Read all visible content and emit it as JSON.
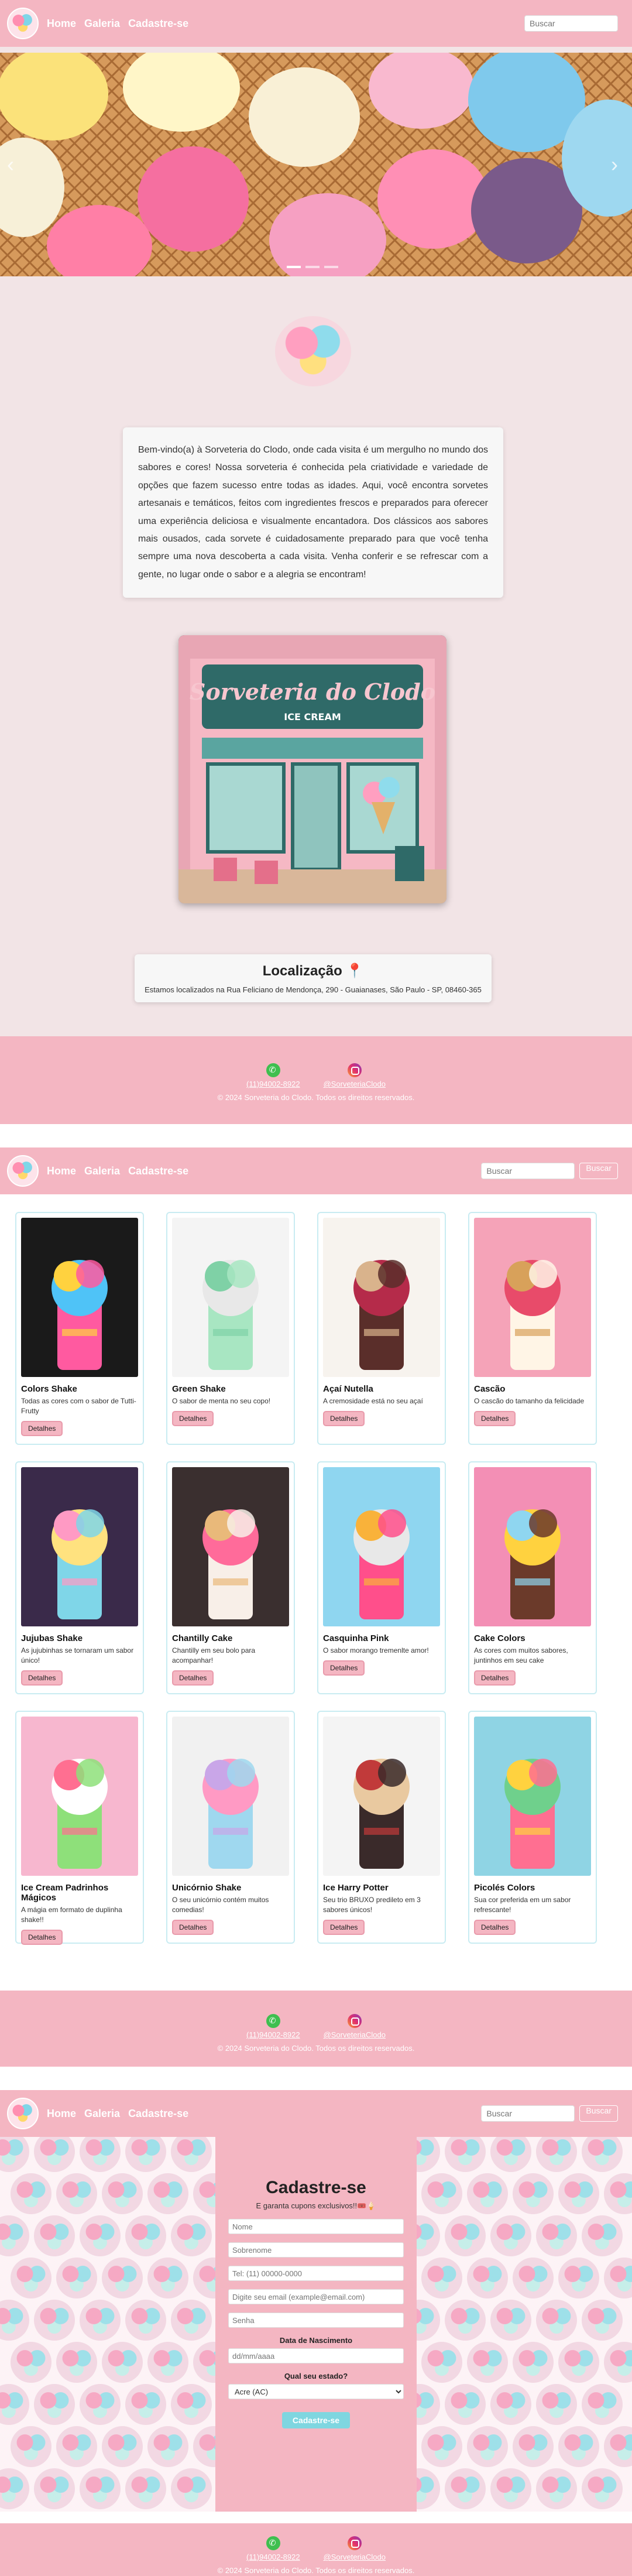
{
  "nav": {
    "links": [
      "Home",
      "Galeria",
      "Cadastre-se"
    ],
    "search_placeholder": "Buscar",
    "search_button": "Buscar"
  },
  "home": {
    "welcome_text": "Bem-vindo(a) à Sorveteria do Clodo, onde cada visita é um mergulho no mundo dos sabores e cores! Nossa sorveteria é conhecida pela criatividade e variedade de opções que fazem sucesso entre todas as idades. Aqui, você encontra sorvetes artesanais e temáticos, feitos com ingredientes frescos e preparados para oferecer uma experiência deliciosa e visualmente encantadora. Dos clássicos aos sabores mais ousados, cada sorvete é cuidadosamente preparado para que você tenha sempre uma nova descoberta a cada visita. Venha conferir e se refrescar com a gente, no lugar onde o sabor e a alegria se encontram!",
    "storefront_sign": "Sorveteria do Clodo",
    "storefront_sub": "ICE CREAM",
    "location_title": "Localização 📍",
    "location_text": "Estamos localizados na Rua Feliciano de Mendonça, 290 - Guaianases, São Paulo - SP, 08460-365"
  },
  "footer": {
    "phone": "(11)94002-8922",
    "instagram": "@SorveteriaClodo",
    "copyright": "© 2024 Sorveteria do Clodo. Todos os direitos reservados."
  },
  "gallery": {
    "button_label": "Detalhes",
    "items": [
      {
        "title": "Colors Shake",
        "desc": "Todas as cores com o sabor de Tutti-Frutty",
        "colors": [
          "#1a1a1a",
          "#ff5aa0",
          "#ffd23f",
          "#4fc3f7"
        ]
      },
      {
        "title": "Green Shake",
        "desc": "O sabor de menta no seu copo!",
        "colors": [
          "#f4f4f4",
          "#a8e6c2",
          "#7fd1a6",
          "#e8e8e8"
        ]
      },
      {
        "title": "Açaí Nutella",
        "desc": "A cremosidade está no seu açaí",
        "colors": [
          "#f7f3ee",
          "#5a2e2a",
          "#d9b38c",
          "#b52b4a"
        ]
      },
      {
        "title": "Cascão",
        "desc": "O cascão do tamanho da felicidade",
        "colors": [
          "#f5a3b8",
          "#fff5e6",
          "#d8a15a",
          "#e84b6a"
        ]
      },
      {
        "title": "Jujubas Shake",
        "desc": "As jujubinhas se tornaram um sabor único!",
        "colors": [
          "#3a2a4a",
          "#7fd6e8",
          "#ff9ac4",
          "#ffe27f"
        ]
      },
      {
        "title": "Chantilly Cake",
        "desc": "Chantilly em seu bolo para acompanhar!",
        "colors": [
          "#3a2f2f",
          "#f8efe8",
          "#e9b97a",
          "#ff6b9a"
        ]
      },
      {
        "title": "Casquinha Pink",
        "desc": "O sabor morango tremenlte amor!",
        "colors": [
          "#8fd6f0",
          "#ff4f8b",
          "#f9b23a",
          "#e8e8e8"
        ]
      },
      {
        "title": "Cake Colors",
        "desc": "As cores com muitos sabores, juntinhos em seu cake",
        "colors": [
          "#f38fb5",
          "#6b3a2a",
          "#8fd6f0",
          "#ffd23f"
        ]
      },
      {
        "title": "Ice Cream Padrinhos Mágicos",
        "desc": "A mágia em formato de duplinha shake!!",
        "colors": [
          "#f7b7cf",
          "#8ee07a",
          "#ff6f91",
          "#ffffff"
        ]
      },
      {
        "title": "Unicórnio Shake",
        "desc": "O seu unicórnio contém muitos comedias!",
        "colors": [
          "#f1f1f1",
          "#9fd8ef",
          "#c9a6e8",
          "#ff9ac4"
        ]
      },
      {
        "title": "Ice Harry Potter",
        "desc": "Seu trio BRUXO predileto em 3 sabores únicos!",
        "colors": [
          "#f4f4f4",
          "#3a2a2a",
          "#c13a3a",
          "#e9c9a0"
        ]
      },
      {
        "title": "Picolés Colors",
        "desc": "Sua cor preferida em um sabor refrescante!",
        "colors": [
          "#8fd4e4",
          "#ff6f91",
          "#ffd23f",
          "#6fd08c"
        ]
      }
    ]
  },
  "signup": {
    "title": "Cadastre-se",
    "subtitle": "E garanta cupons exclusivos!!🎟️🍦",
    "fields": {
      "name": "Nome",
      "surname": "Sobrenome",
      "phone": "Tel: (11) 00000-0000",
      "email": "Digite seu email (example@email.com)",
      "password": "Senha",
      "date": "dd/mm/aaaa"
    },
    "birth_label": "Data de Nascimento",
    "state_label": "Qual seu estado?",
    "state_value": "Acre (AC)",
    "submit": "Cadastre-se"
  }
}
